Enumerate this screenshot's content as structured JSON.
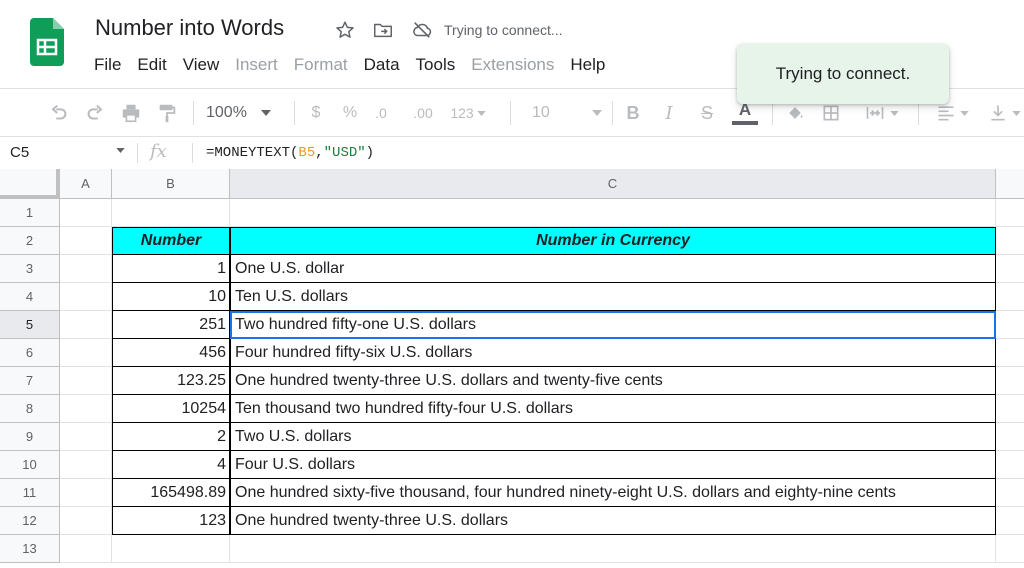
{
  "doc": {
    "title": "Number into Words",
    "status": "Trying to connect..."
  },
  "menu": [
    "File",
    "Edit",
    "View",
    "Insert",
    "Format",
    "Data",
    "Tools",
    "Extensions",
    "Help"
  ],
  "menu_disabled": [
    "Insert",
    "Format",
    "Extensions"
  ],
  "toast": "Trying to connect.",
  "toolbar": {
    "zoom": "100%",
    "currency": "$",
    "percent": "%",
    "dec_decrease": ".0",
    "dec_increase": ".00",
    "more_formats": "123",
    "font_size": "10",
    "bold": "B",
    "italic": "I",
    "strike": "S",
    "text_color": "A"
  },
  "formula_bar": {
    "name_box": "C5",
    "fx": "fx",
    "formula_prefix": "=MONEYTEXT(",
    "formula_ref": "B5",
    "formula_comma": ",",
    "formula_str": "\"USD\"",
    "formula_suffix": ")"
  },
  "columns": [
    "A",
    "B",
    "C"
  ],
  "rows": [
    "1",
    "2",
    "3",
    "4",
    "5",
    "6",
    "7",
    "8",
    "9",
    "10",
    "11",
    "12",
    "13"
  ],
  "table": {
    "headers": [
      "Number",
      "Number in Currency"
    ],
    "rows": [
      [
        "1",
        "One U.S. dollar"
      ],
      [
        "10",
        "Ten U.S. dollars"
      ],
      [
        "251",
        "Two hundred fifty-one U.S. dollars"
      ],
      [
        "456",
        "Four hundred fifty-six U.S. dollars"
      ],
      [
        "123.25",
        "One hundred twenty-three U.S. dollars and twenty-five cents"
      ],
      [
        "10254",
        "Ten thousand two hundred fifty-four U.S. dollars"
      ],
      [
        "2",
        "Two U.S. dollars"
      ],
      [
        "4",
        "Four U.S. dollars"
      ],
      [
        "165498.89",
        "One hundred sixty-five thousand, four hundred ninety-eight U.S. dollars and eighty-nine cents"
      ],
      [
        "123",
        "One hundred twenty-three U.S. dollars"
      ]
    ]
  },
  "selected_cell": "C5",
  "colors": {
    "header_fill": "#00ffff",
    "selection": "#1a73e8",
    "toast_bg": "#e6f4ea",
    "logo": "#0f9d58"
  },
  "icons": [
    "sheets-logo",
    "star-icon",
    "move-folder-icon",
    "cloud-offline-icon",
    "undo-icon",
    "redo-icon",
    "print-icon",
    "paint-format-icon",
    "fill-color-icon",
    "borders-icon",
    "merge-cells-icon",
    "align-icon",
    "valign-icon"
  ]
}
